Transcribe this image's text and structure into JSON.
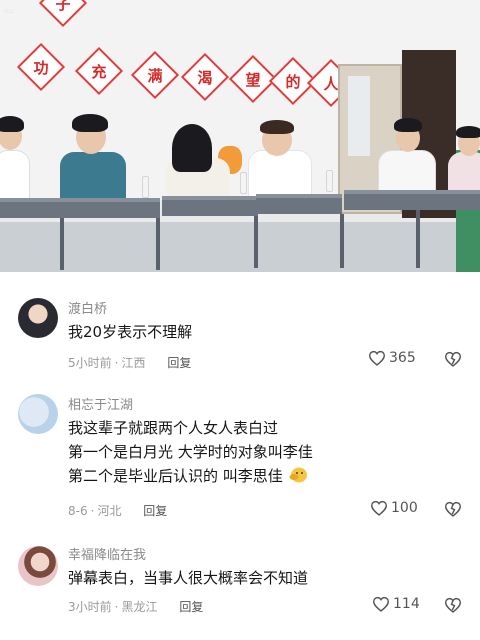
{
  "video": {
    "watermark": "...",
    "slogan_chars": [
      "子",
      "功",
      "充",
      "满",
      "渴",
      "望",
      "的",
      "人"
    ]
  },
  "comments": [
    {
      "username": "渡白桥",
      "lines": [
        "我20岁表示不理解"
      ],
      "time": "5小时前",
      "location": "江西",
      "reply_label": "回复",
      "likes": "365",
      "like_icon": "heart-outline-icon",
      "dislike_icon": "broken-heart-icon"
    },
    {
      "username": "相忘于江湖",
      "lines": [
        "我这辈子就跟两个人女人表白过",
        "第一个是白月光 大学时的对象叫李佳",
        "第二个是毕业后认识的 叫李思佳"
      ],
      "time": "8-6",
      "location": "河北",
      "reply_label": "回复",
      "likes": "100",
      "trailing_emoji": "thinking-face-emoji",
      "like_icon": "heart-outline-icon",
      "dislike_icon": "broken-heart-icon"
    },
    {
      "username": "幸福降临在我",
      "lines": [
        "弹幕表白，当事人很大概率会不知道"
      ],
      "time": "3小时前",
      "location": "黑龙江",
      "reply_label": "回复",
      "likes": "114",
      "like_icon": "heart-outline-icon",
      "dislike_icon": "broken-heart-icon"
    }
  ],
  "colors": {
    "slogan_red": "#e43a3a",
    "username_gray": "#8a8a8a",
    "meta_gray": "#9a9a9a",
    "text": "#161616"
  }
}
